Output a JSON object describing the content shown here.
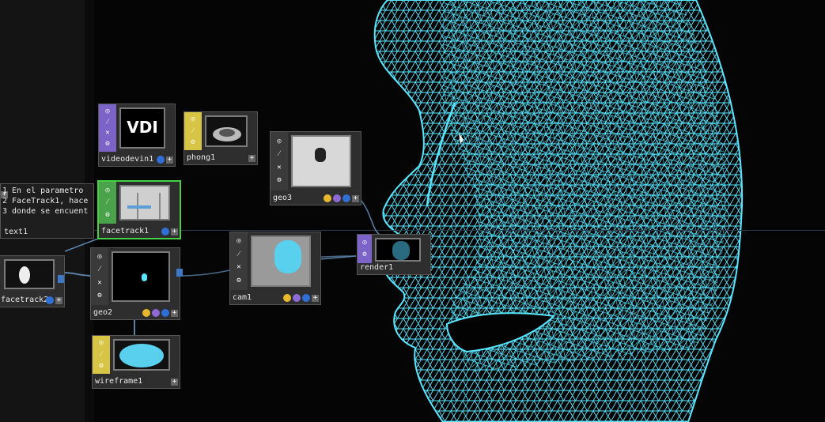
{
  "nodes": {
    "videodevin": {
      "name": "videodevin1",
      "preview_text": "VDI"
    },
    "phong": {
      "name": "phong1"
    },
    "geo3": {
      "name": "geo3"
    },
    "facetrack1": {
      "name": "facetrack1"
    },
    "text": {
      "name": "text1",
      "lines": [
        "1 En el parametro",
        "2 FaceTrack1, hace",
        "3 donde se encuent"
      ]
    },
    "facetrack2": {
      "name": "facetrack2"
    },
    "geo2": {
      "name": "geo2"
    },
    "cam": {
      "name": "cam1"
    },
    "render": {
      "name": "render1"
    },
    "wireframe": {
      "name": "wireframe1"
    }
  },
  "icons": {
    "mesh": "wireframe-face-mesh",
    "cursor": "mouse-cursor-icon"
  },
  "colors": {
    "mesh": "#58e6ff",
    "background": "#050505",
    "selected": "#46d046",
    "top_purple": "#7b63c8",
    "mat_yellow": "#d8c445",
    "connector": "#3c78c8"
  }
}
